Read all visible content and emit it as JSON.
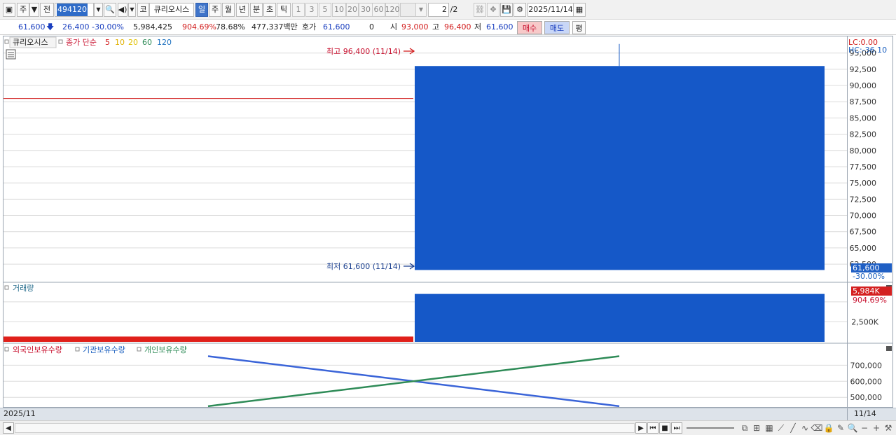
{
  "toolbar": {
    "market": "주",
    "prev_label": "전",
    "code": "494120",
    "sound_icon": "speaker-icon",
    "ko_label": "코",
    "name": "큐리오시스",
    "periods": [
      "일",
      "주",
      "월",
      "년",
      "분",
      "초",
      "틱"
    ],
    "active_period": "일",
    "intervals": [
      "1",
      "3",
      "5",
      "10",
      "20",
      "30",
      "60",
      "120"
    ],
    "page": "2",
    "page_total": "/2",
    "date": "2025/11/14"
  },
  "quote": {
    "price": "61,600",
    "change": "26,400",
    "change_pct": "-30.00%",
    "volume": "5,984,425",
    "volume_pct": "904.69%",
    "ratio": "78.68%",
    "amount": "477,337백만",
    "hoga_label": "호가",
    "hoga": "61,600",
    "zero": "0",
    "open_label": "시",
    "open": "93,000",
    "high_label": "고",
    "high": "96,400",
    "low_label": "저",
    "low": "61,600",
    "buy": "매수",
    "sell": "매도",
    "avg": "평"
  },
  "price_pane": {
    "legend_name": "큐리오시스",
    "legend_ma": "종가 단순",
    "ma_periods": [
      "5",
      "10",
      "20",
      "60",
      "120"
    ],
    "ma_colors": [
      "#d11a1a",
      "#e0b000",
      "#e0c000",
      "#2e8b57",
      "#1a6fbf"
    ],
    "high_note": "최고 96,400 (11/14)",
    "low_note": "최저 61,600 (11/14)",
    "lc_label": "LC:0.00",
    "hc_label": "HC:-36.10",
    "price_tag": "61,600",
    "price_tag_pct": "-30.00%",
    "y_ticks": [
      "95,000",
      "92,500",
      "90,000",
      "87,500",
      "85,000",
      "82,500",
      "80,000",
      "77,500",
      "75,000",
      "72,500",
      "70,000",
      "67,500",
      "65,000",
      "62,500"
    ]
  },
  "volume_pane": {
    "legend": "거래량",
    "tag": "5,984K",
    "tag_pct": "904.69%",
    "y_ticks": [
      "2,500K"
    ]
  },
  "holdings_pane": {
    "legend": [
      "외국인보유수량",
      "기관보유수량",
      "개인보유수량"
    ],
    "legend_colors": [
      "#c8102e",
      "#1a5fbf",
      "#2e8b57"
    ],
    "y_ticks": [
      "700,000",
      "600,000",
      "500,000"
    ]
  },
  "footer": {
    "month": "2025/11",
    "last_date": "11/14"
  },
  "chart_data": [
    {
      "type": "candlestick",
      "candles": [
        {
          "date": "11/14",
          "open": 93000,
          "high": 96400,
          "low": 61600,
          "close": 61600
        }
      ],
      "prev_close": 88000,
      "ylim": [
        61000,
        96800
      ]
    },
    {
      "type": "bar",
      "categories": [
        "prev",
        "11/14"
      ],
      "values": [
        661459,
        5984425
      ],
      "ylim": [
        0,
        6300000
      ]
    },
    {
      "type": "line",
      "x": [
        "prev",
        "11/14"
      ],
      "series": [
        {
          "name": "기관보유수량",
          "values": [
            756000,
            445000
          ]
        },
        {
          "name": "개인보유수량",
          "values": [
            445000,
            756000
          ]
        }
      ],
      "ylim": [
        440000,
        780000
      ]
    }
  ]
}
